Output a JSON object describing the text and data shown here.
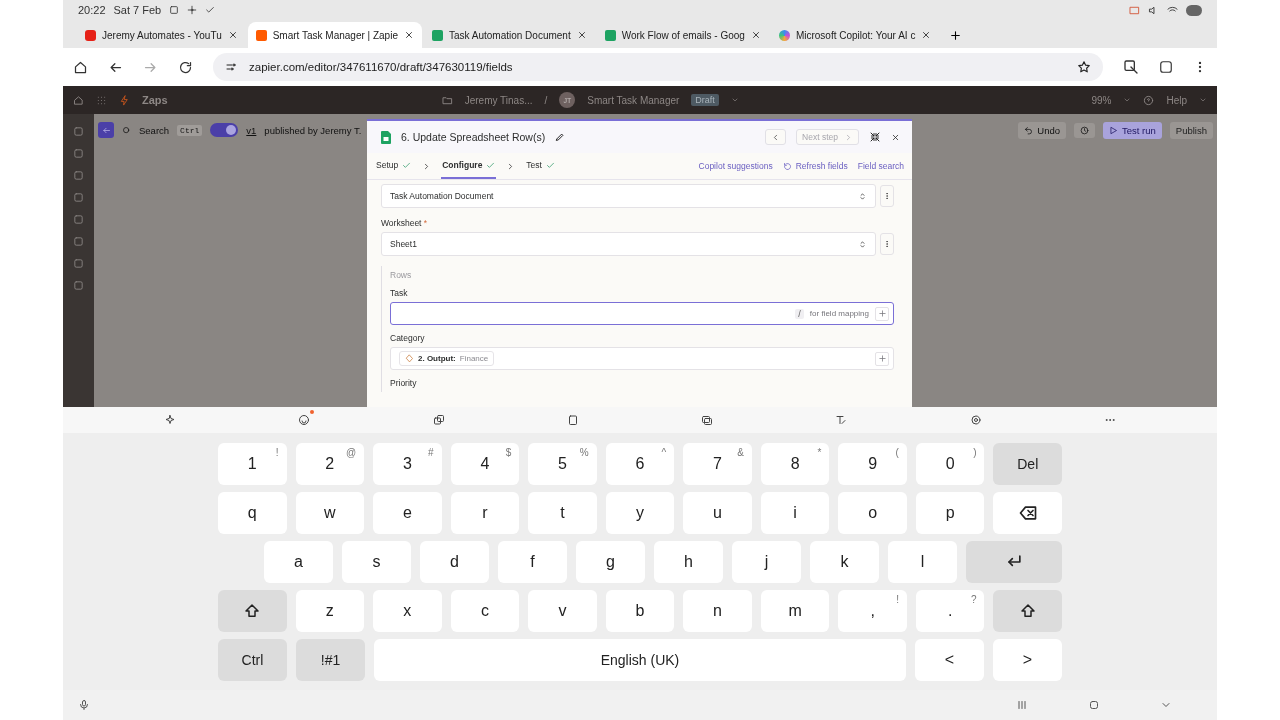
{
  "status_bar": {
    "time": "20:22",
    "date": "Sat 7 Feb"
  },
  "browser_tabs": [
    {
      "title": "Jeremy Automates - YouTu",
      "kind": "video",
      "selected": false
    },
    {
      "title": "Smart Task Manager | Zapie",
      "kind": "zapier",
      "selected": true
    },
    {
      "title": "Task Automation Document",
      "kind": "sheet",
      "selected": false
    },
    {
      "title": "Work Flow of emails - Goog",
      "kind": "sheet",
      "selected": false
    },
    {
      "title": "Microsoft Copilot: Your AI c",
      "kind": "copilot",
      "selected": false
    }
  ],
  "address_bar": {
    "url": "zapier.com/editor/347611670/draft/347630119/fields"
  },
  "app_header": {
    "app_name": "Zaps",
    "folder": "Jeremy Tinas...",
    "separator": "/",
    "avatar": "JT",
    "zap_name": "Smart Task Manager",
    "status": "Draft",
    "zoom": "99%",
    "help": "Help"
  },
  "canvas_toolbar": {
    "search": "Search",
    "shortcut": "Ctrl",
    "toggle_on": true,
    "version": "v1",
    "published": "published by Jeremy T.",
    "undo": "Undo",
    "test_run": "Test run",
    "publish": "Publish"
  },
  "step_panel": {
    "title": "6. Update Spreadsheet Row(s)",
    "next_step": "Next step",
    "steps": [
      {
        "label": "Setup",
        "done": true,
        "selected": false
      },
      {
        "label": "Configure",
        "done": true,
        "selected": true
      },
      {
        "label": "Test",
        "done": true,
        "selected": false
      }
    ],
    "actions": [
      {
        "label": "Copilot suggestions",
        "kind": "plain"
      },
      {
        "label": "Refresh fields",
        "kind": "refresh"
      },
      {
        "label": "Field search",
        "kind": "plain"
      }
    ],
    "spreadsheet_value": "Task Automation Document",
    "worksheet": {
      "label": "Worksheet",
      "required": true,
      "value": "Sheet1"
    },
    "rows": {
      "label": "Rows",
      "fields": [
        {
          "label": "Task",
          "kind": "input",
          "focused": true,
          "hint_key": "/",
          "hint": "for field mapping"
        },
        {
          "label": "Category",
          "kind": "mapped",
          "focused": false,
          "step": "2. Output:",
          "value": "Finance"
        }
      ],
      "next_label": "Priority"
    }
  },
  "keyboard": {
    "key_rows": [
      {
        "keys": [
          {
            "label": "1",
            "sub": "!",
            "kind": "char"
          },
          {
            "label": "2",
            "sub": "@",
            "kind": "char"
          },
          {
            "label": "3",
            "sub": "#",
            "kind": "char"
          },
          {
            "label": "4",
            "sub": "$",
            "kind": "char"
          },
          {
            "label": "5",
            "sub": "%",
            "kind": "char"
          },
          {
            "label": "6",
            "sub": "^",
            "kind": "char"
          },
          {
            "label": "7",
            "sub": "&",
            "kind": "char"
          },
          {
            "label": "8",
            "sub": "*",
            "kind": "char"
          },
          {
            "label": "9",
            "sub": "(",
            "kind": "char"
          },
          {
            "label": "0",
            "sub": ")",
            "kind": "char"
          },
          {
            "label": "Del",
            "kind": "func"
          }
        ]
      },
      {
        "keys": [
          {
            "label": "q",
            "kind": "char"
          },
          {
            "label": "w",
            "kind": "char"
          },
          {
            "label": "e",
            "kind": "char"
          },
          {
            "label": "r",
            "kind": "char"
          },
          {
            "label": "t",
            "kind": "char"
          },
          {
            "label": "y",
            "kind": "char"
          },
          {
            "label": "u",
            "kind": "char"
          },
          {
            "label": "i",
            "kind": "char"
          },
          {
            "label": "o",
            "kind": "char"
          },
          {
            "label": "p",
            "kind": "char"
          },
          {
            "kind": "backspace"
          }
        ]
      },
      {
        "keys": [
          {
            "label": "a",
            "kind": "char"
          },
          {
            "label": "s",
            "kind": "char"
          },
          {
            "label": "d",
            "kind": "char"
          },
          {
            "label": "f",
            "kind": "char"
          },
          {
            "label": "g",
            "kind": "char"
          },
          {
            "label": "h",
            "kind": "char"
          },
          {
            "label": "j",
            "kind": "char"
          },
          {
            "label": "k",
            "kind": "char"
          },
          {
            "label": "l",
            "kind": "char"
          },
          {
            "kind": "enter"
          }
        ]
      },
      {
        "keys": [
          {
            "kind": "shift"
          },
          {
            "label": "z",
            "kind": "char"
          },
          {
            "label": "x",
            "kind": "char"
          },
          {
            "label": "c",
            "kind": "char"
          },
          {
            "label": "v",
            "kind": "char"
          },
          {
            "label": "b",
            "kind": "char"
          },
          {
            "label": "n",
            "kind": "char"
          },
          {
            "label": "m",
            "kind": "char"
          },
          {
            "label": ",",
            "sub": "!",
            "kind": "char"
          },
          {
            "label": ".",
            "sub": "?",
            "kind": "char"
          },
          {
            "kind": "shift"
          }
        ]
      }
    ],
    "bottom_row": {
      "ctrl": "Ctrl",
      "symbols": "!#1",
      "space": "English (UK)",
      "left": "<",
      "right": ">"
    }
  }
}
